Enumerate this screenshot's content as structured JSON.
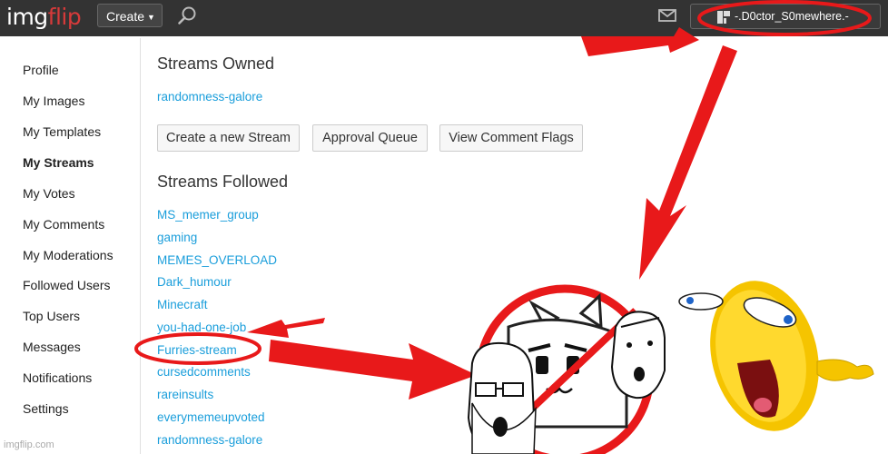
{
  "topbar": {
    "logo_part1": "img",
    "logo_part2": "flip",
    "create_label": "Create",
    "username": "-.D0ctor_S0mewhere.-"
  },
  "sidebar": {
    "items": [
      {
        "label": "Profile"
      },
      {
        "label": "My Images"
      },
      {
        "label": "My Templates"
      },
      {
        "label": "My Streams"
      },
      {
        "label": "My Votes"
      },
      {
        "label": "My Comments"
      },
      {
        "label": "My Moderations"
      },
      {
        "label": "Followed Users"
      },
      {
        "label": "Top Users"
      },
      {
        "label": "Messages"
      },
      {
        "label": "Notifications"
      },
      {
        "label": "Settings"
      }
    ],
    "active_item": "My Streams"
  },
  "main": {
    "owned_title": "Streams Owned",
    "owned_streams": [
      "randomness-galore"
    ],
    "buttons": {
      "create_stream": "Create a new Stream",
      "approval_queue": "Approval Queue",
      "comment_flags": "View Comment Flags"
    },
    "followed_title": "Streams Followed",
    "followed_streams": [
      "MS_memer_group",
      "gaming",
      "MEMES_OVERLOAD",
      "Dark_humour",
      "Minecraft",
      "you-had-one-job",
      "Furries-stream",
      "cursedcomments",
      "rareinsults",
      "everymemeupvoted",
      "randomness-galore"
    ]
  },
  "watermark": "imgflip.com",
  "colors": {
    "topbar": "#333333",
    "link": "#1a9edb",
    "annotation_red": "#e8191a",
    "emoji_yellow": "#f5c400"
  }
}
